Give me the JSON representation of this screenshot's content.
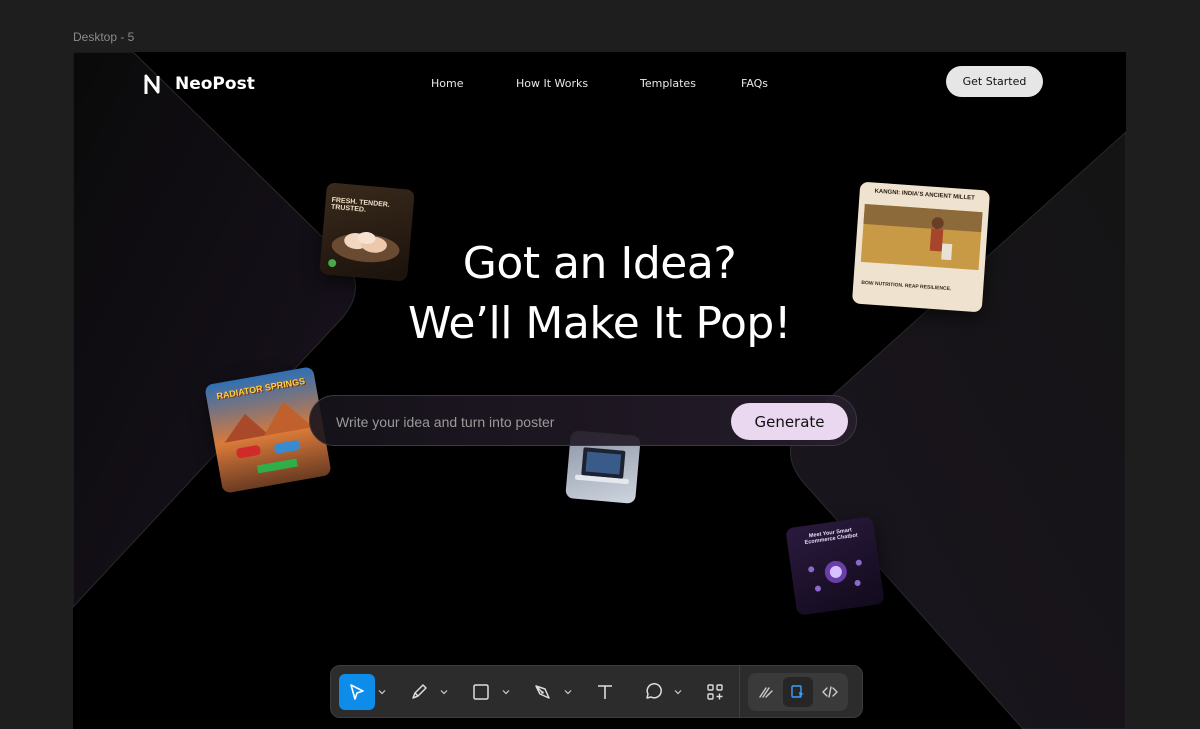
{
  "canvas": {
    "frame_label": "Desktop - 5"
  },
  "site": {
    "brand": "NeoPost",
    "nav": [
      "Home",
      "How It Works",
      "Templates",
      "FAQs"
    ],
    "cta_label": "Get Started"
  },
  "hero": {
    "line1": "Got an Idea?",
    "line2": "We’ll Make It Pop!"
  },
  "prompt": {
    "placeholder": "Write your idea and turn into poster",
    "button_label": "Generate"
  },
  "posters": {
    "chicken": {
      "headline": "FRESH. TENDER. TRUSTED."
    },
    "millet": {
      "headline": "KANGNI: INDIA’S ANCIENT MILLET",
      "footer": "BOW NUTRITION. REAP RESILIENCE."
    },
    "radiator": {
      "headline": "RADIATOR SPRINGS"
    },
    "chatbot": {
      "headline": "Meet Your Smart Ecommerce Chatbot"
    }
  },
  "toolbar": {
    "tools": [
      "move-tool",
      "pen-pencil-tool",
      "frame-shape-tool",
      "pen-tool",
      "text-tool",
      "comment-tool",
      "components-tool"
    ],
    "modes": [
      "draw-mode",
      "design-mode",
      "dev-mode"
    ],
    "active_tool": "move-tool",
    "active_mode": "design-mode",
    "accent": "#0d8ce9"
  }
}
